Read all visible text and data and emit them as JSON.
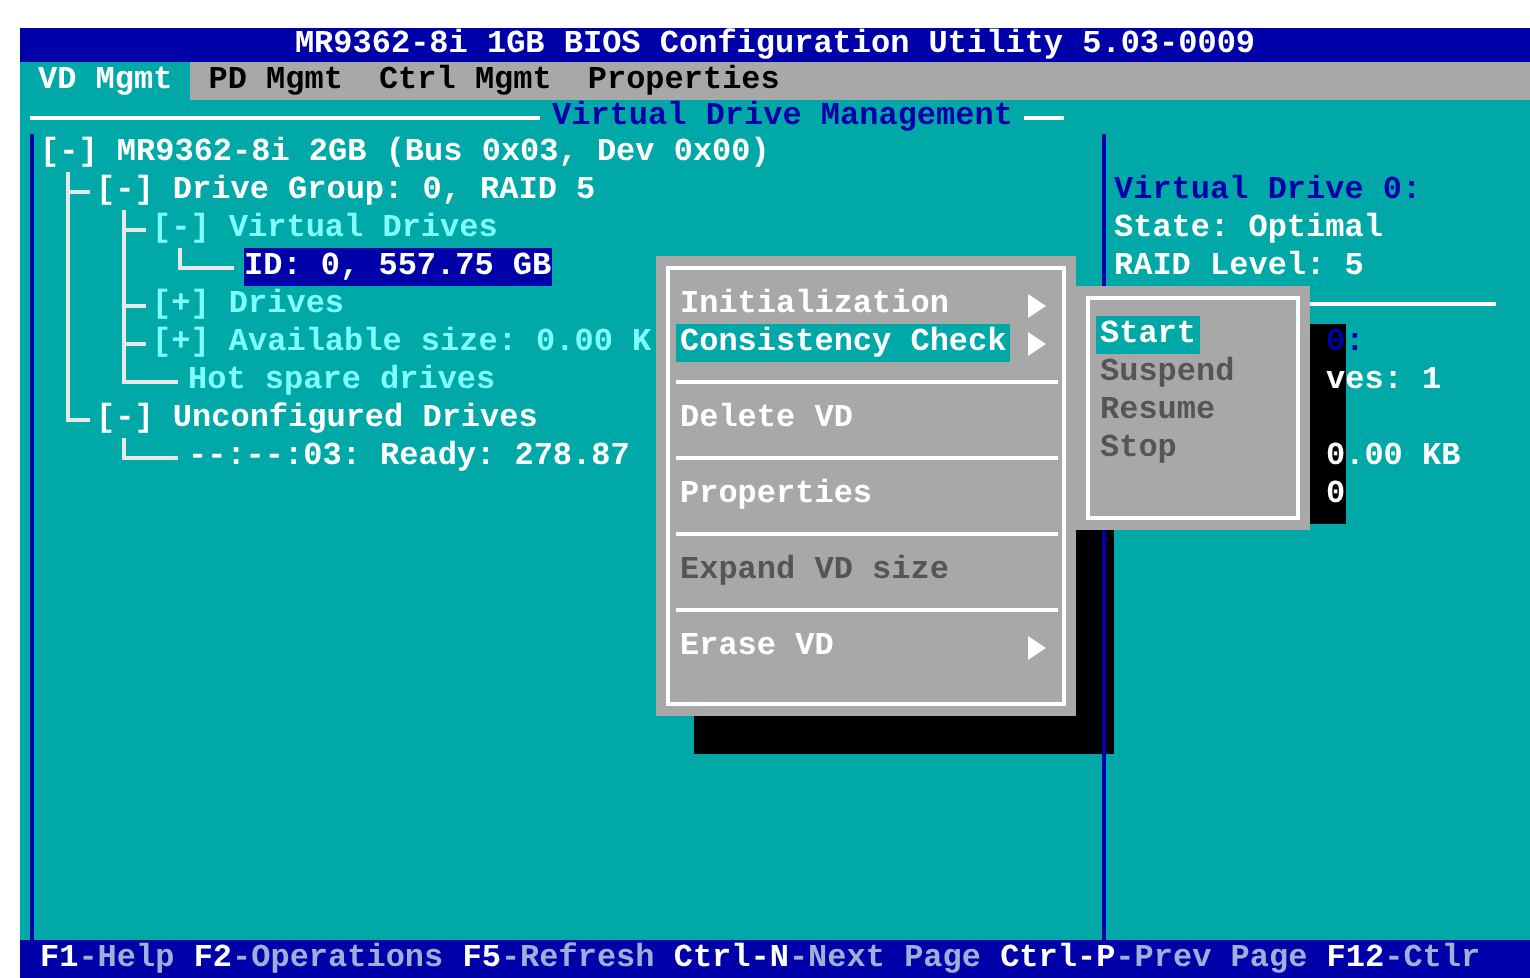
{
  "window": {
    "title": "MR9362-8i 1GB BIOS Configuration Utility 5.03-0009"
  },
  "tabs": [
    {
      "label": "VD Mgmt",
      "selected": true
    },
    {
      "label": "PD Mgmt",
      "selected": false
    },
    {
      "label": "Ctrl Mgmt",
      "selected": false
    },
    {
      "label": "Properties",
      "selected": false
    }
  ],
  "panel_title": "Virtual Drive Management",
  "tree": [
    {
      "label": "[-] MR9362-8i 2GB (Bus 0x03, Dev 0x00)",
      "color": "#ffffff",
      "selected": false,
      "children": [
        {
          "label": "[-] Drive Group: 0, RAID 5",
          "color": "#ffffff",
          "selected": false,
          "leaf": false,
          "children": [
            {
              "label": "[-] Virtual Drives",
              "color": "#7fffff",
              "selected": false,
              "leaf": false,
              "children": [
                {
                  "label": "ID: 0, 557.75 GB",
                  "selected": true,
                  "leaf": true
                }
              ]
            },
            {
              "label": "[+] Drives",
              "color": "#7fffff",
              "selected": false,
              "leaf": false
            },
            {
              "label": "[+] Available size: 0.00 K",
              "color": "#7fffff",
              "selected": false,
              "leaf": false
            },
            {
              "label": "Hot spare drives",
              "color": "#7fffff",
              "selected": false,
              "leaf": true
            }
          ]
        },
        {
          "label": "[-] Unconfigured Drives",
          "color": "#ffffff",
          "selected": false,
          "leaf": false,
          "children": [
            {
              "label": "--:--:03: Ready: 278.87",
              "color": "#ffffff",
              "selected": false,
              "leaf": true
            }
          ]
        }
      ]
    }
  ],
  "details": [
    {
      "text": "Virtual Drive 0:",
      "kind": "heading"
    },
    {
      "text": "State: Optimal",
      "kind": "value"
    },
    {
      "text": "RAID Level: 5",
      "kind": "value"
    }
  ],
  "covered_details": [
    {
      "text": "0:",
      "kind": "heading"
    },
    {
      "text": "ves: 1",
      "kind": "value"
    },
    {
      "text": "0.00 KB",
      "kind": "value"
    },
    {
      "text": "0",
      "kind": "value"
    }
  ],
  "menu": {
    "groups": [
      [
        {
          "label": "Initialization",
          "selected": false,
          "disabled": false,
          "submenu": true
        },
        {
          "label": "Consistency Check",
          "selected": true,
          "disabled": false,
          "submenu": true
        }
      ],
      [
        {
          "label": "Delete VD",
          "selected": false,
          "disabled": false,
          "submenu": false
        }
      ],
      [
        {
          "label": "Properties",
          "selected": false,
          "disabled": false,
          "submenu": false
        }
      ],
      [
        {
          "label": "Expand VD size",
          "selected": false,
          "disabled": true,
          "submenu": false
        }
      ],
      [
        {
          "label": "Erase VD",
          "selected": false,
          "disabled": false,
          "submenu": true
        }
      ]
    ]
  },
  "submenu": [
    {
      "label": "Start",
      "selected": true,
      "disabled": false
    },
    {
      "label": "Suspend",
      "selected": false,
      "disabled": true
    },
    {
      "label": "Resume",
      "selected": false,
      "disabled": true
    },
    {
      "label": "Stop",
      "selected": false,
      "disabled": true
    }
  ],
  "status_bar": [
    {
      "key": "F1",
      "text": "-Help"
    },
    {
      "key": "F2",
      "text": "-Operations"
    },
    {
      "key": "F5",
      "text": "-Refresh"
    },
    {
      "key": "Ctrl-N",
      "text": "-Next Page"
    },
    {
      "key": "Ctrl-P",
      "text": "-Prev Page"
    },
    {
      "key": "F12",
      "text": "-Ctlr"
    }
  ]
}
